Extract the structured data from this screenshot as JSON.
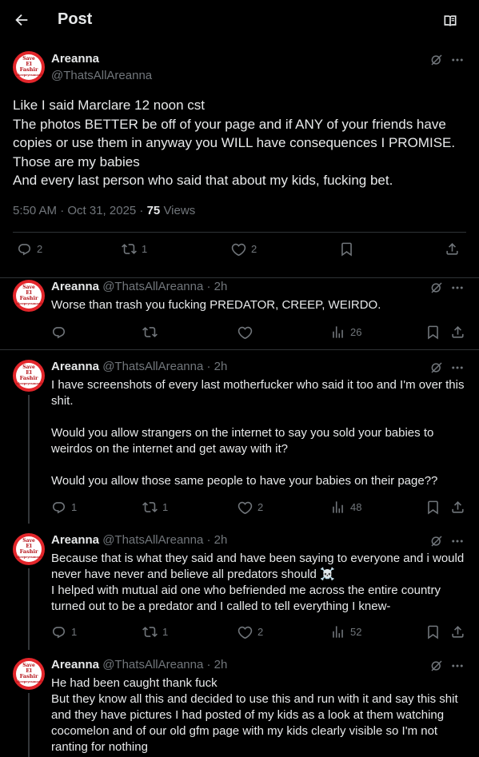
{
  "header": {
    "title": "Post"
  },
  "icons": {
    "back": "arrow-left-icon",
    "reader": "reader-mode-icon",
    "grok": "grok-icon",
    "more": "more-icon"
  },
  "colors": {
    "background": "#000000",
    "text": "#e7e9ea",
    "muted": "#71767b",
    "divider": "#2f3336",
    "avatar": "#e3262b"
  },
  "main_post": {
    "avatar_text": [
      "Save",
      "El Fashir",
      "#keepeyesonsudan"
    ],
    "name": "Areanna",
    "handle": "@ThatsAllAreanna",
    "lines": [
      "Like I said Marclare 12 noon cst",
      "The photos BETTER be off of your page and if ANY of your friends have copies or use them in anyway you WILL have consequences I PROMISE.",
      "Those are my babies",
      "And every last person who said that about my kids, fucking bet."
    ],
    "time": "5:50 AM · Oct 31, 2025 · ",
    "views": "75",
    "views_label": " Views",
    "stats": {
      "replies": "2",
      "reposts": "1",
      "likes": "2"
    }
  },
  "replies": [
    {
      "name": "Areanna",
      "handle": "@ThatsAllAreanna",
      "time": "· 2h",
      "paragraphs": [
        "Worse than trash you fucking PREDATOR, CREEP, WEIRDO."
      ],
      "stats": {
        "replies": "",
        "reposts": "",
        "likes": "",
        "views": "26"
      }
    },
    {
      "name": "Areanna",
      "handle": "@ThatsAllAreanna",
      "time": "· 2h",
      "paragraphs": [
        "I have screenshots of every last motherfucker who said it too and I'm over this shit.",
        "Would you allow strangers on the internet to say you sold your babies to weirdos on the internet and get away with it?",
        "Would you allow those same people to have your babies on their page??"
      ],
      "stats": {
        "replies": "1",
        "reposts": "1",
        "likes": "2",
        "views": "48"
      }
    },
    {
      "name": "Areanna",
      "handle": "@ThatsAllAreanna",
      "time": "· 2h",
      "paragraphs": [
        "Because that is what they said and have been saying to everyone and i would never have never and believe all predators should ☠️\nI helped with mutual aid one who befriended me across the entire country turned out to be a predator and I called to tell everything I knew-"
      ],
      "stats": {
        "replies": "1",
        "reposts": "1",
        "likes": "2",
        "views": "52"
      }
    },
    {
      "name": "Areanna",
      "handle": "@ThatsAllAreanna",
      "time": "· 2h",
      "paragraphs": [
        "He had been caught thank fuck\nBut they know all this and decided to use this and run with it and say this shit and they have pictures I had posted of my kids as a look at them watching cocomelon and of our old gfm page with my kids clearly visible so I'm not ranting for nothing"
      ],
      "stats": {
        "replies": "",
        "reposts": "",
        "likes": "",
        "views": ""
      }
    }
  ]
}
